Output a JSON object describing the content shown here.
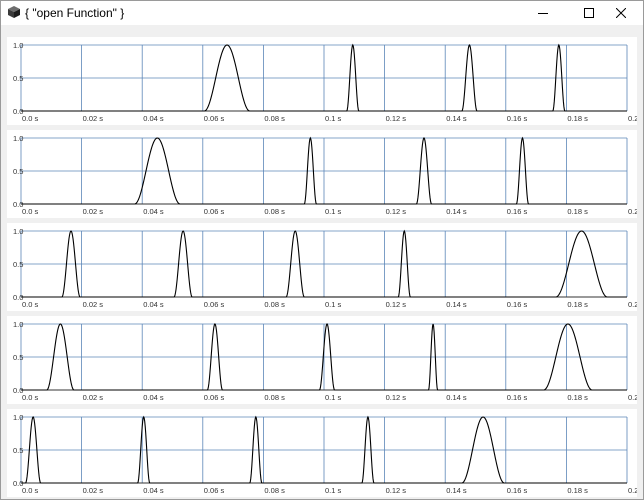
{
  "window": {
    "title": "{ \"open Function\" }",
    "icon": "cube-icon",
    "controls": [
      "minimize-icon",
      "maximize-icon",
      "close-icon"
    ]
  },
  "chart_data": [
    {
      "type": "line",
      "xlim": [
        0,
        0.2
      ],
      "ylim": [
        0,
        1.0
      ],
      "x_ticks": [
        "0.0 s",
        "0.02 s",
        "0.04 s",
        "0.06 s",
        "0.08 s",
        "0.1 s",
        "0.12 s",
        "0.14 s",
        "0.16 s",
        "0.18 s",
        "0.2 s"
      ],
      "y_ticks": [
        "0.0",
        "0.5",
        "1.0"
      ],
      "grid": true,
      "pulses": [
        {
          "start": 0.0605,
          "end": 0.0755
        },
        {
          "start": 0.1075,
          "end": 0.1115
        },
        {
          "start": 0.1455,
          "end": 0.1505
        },
        {
          "start": 0.1755,
          "end": 0.1795
        }
      ]
    },
    {
      "type": "line",
      "xlim": [
        0,
        0.2
      ],
      "ylim": [
        0,
        1.0
      ],
      "x_ticks": [
        "0.0 s",
        "0.02 s",
        "0.04 s",
        "0.06 s",
        "0.08 s",
        "0.1 s",
        "0.12 s",
        "0.14 s",
        "0.16 s",
        "0.18 s",
        "0.2 s"
      ],
      "y_ticks": [
        "0.0",
        "0.5",
        "1.0"
      ],
      "grid": true,
      "pulses": [
        {
          "start": 0.0375,
          "end": 0.0525
        },
        {
          "start": 0.0935,
          "end": 0.0975
        },
        {
          "start": 0.1305,
          "end": 0.1355
        },
        {
          "start": 0.1635,
          "end": 0.1675
        }
      ]
    },
    {
      "type": "line",
      "xlim": [
        0,
        0.2
      ],
      "ylim": [
        0,
        1.0
      ],
      "x_ticks": [
        "0.0 s",
        "0.02 s",
        "0.04 s",
        "0.06 s",
        "0.08 s",
        "0.1 s",
        "0.12 s",
        "0.14 s",
        "0.16 s",
        "0.18 s",
        "0.2 s"
      ],
      "y_ticks": [
        "0.0",
        "0.5",
        "1.0"
      ],
      "grid": true,
      "pulses": [
        {
          "start": 0.0135,
          "end": 0.0195
        },
        {
          "start": 0.0505,
          "end": 0.0565
        },
        {
          "start": 0.0875,
          "end": 0.0935
        },
        {
          "start": 0.1245,
          "end": 0.1285
        },
        {
          "start": 0.1765,
          "end": 0.1935
        }
      ]
    },
    {
      "type": "line",
      "xlim": [
        0,
        0.2
      ],
      "ylim": [
        0,
        1.0
      ],
      "x_ticks": [
        "0.0 s",
        "0.02 s",
        "0.04 s",
        "0.06 s",
        "0.08 s",
        "0.1 s",
        "0.12 s",
        "0.14 s",
        "0.16 s",
        "0.18 s",
        "0.2 s"
      ],
      "y_ticks": [
        "0.0",
        "0.5",
        "1.0"
      ],
      "grid": true,
      "pulses": [
        {
          "start": 0.0085,
          "end": 0.0175
        },
        {
          "start": 0.0615,
          "end": 0.0665
        },
        {
          "start": 0.0985,
          "end": 0.1035
        },
        {
          "start": 0.1345,
          "end": 0.1375
        },
        {
          "start": 0.1725,
          "end": 0.1885
        }
      ]
    },
    {
      "type": "line",
      "xlim": [
        0,
        0.2
      ],
      "ylim": [
        0,
        1.0
      ],
      "x_ticks": [
        "0.0 s",
        "0.02 s",
        "0.04 s",
        "0.06 s",
        "0.08 s",
        "0.1 s",
        "0.12 s",
        "0.14 s",
        "0.16 s",
        "0.18 s",
        "0.2 s"
      ],
      "y_ticks": [
        "0.0",
        "0.5",
        "1.0"
      ],
      "grid": true,
      "pulses": [
        {
          "start": 0.0015,
          "end": 0.0065
        },
        {
          "start": 0.0385,
          "end": 0.0425
        },
        {
          "start": 0.0755,
          "end": 0.0795
        },
        {
          "start": 0.1125,
          "end": 0.1165
        },
        {
          "start": 0.1455,
          "end": 0.1595
        }
      ]
    }
  ]
}
